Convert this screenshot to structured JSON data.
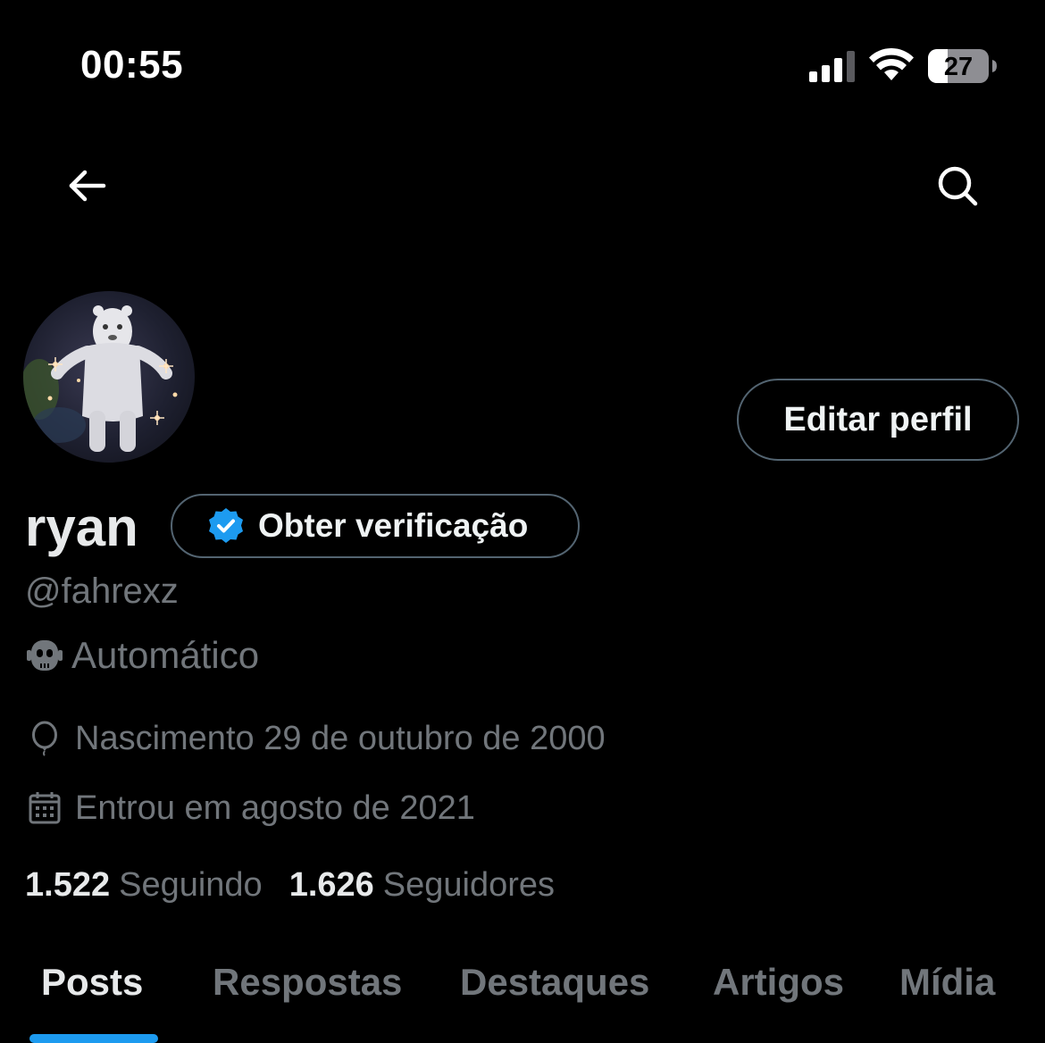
{
  "status_bar": {
    "time": "00:55",
    "battery_level": "27",
    "signal_icon": "cellular-signal-icon",
    "wifi_icon": "wifi-icon",
    "battery_icon": "battery-icon"
  },
  "nav": {
    "back_icon": "arrow-left-icon",
    "search_icon": "search-icon"
  },
  "profile": {
    "name": "ryan",
    "verify_label": "Obter verificação",
    "handle": "@fahrexz",
    "automated_label": "Automático",
    "birth": "Nascimento 29 de outubro de 2000",
    "joined": "Entrou em agosto de 2021",
    "edit_label": "Editar perfil",
    "following_count": "1.522",
    "following_label": "Seguindo",
    "followers_count": "1.626",
    "followers_label": "Seguidores"
  },
  "tabs": [
    {
      "label": "Posts",
      "active": true
    },
    {
      "label": "Respostas",
      "active": false
    },
    {
      "label": "Destaques",
      "active": false
    },
    {
      "label": "Artigos",
      "active": false
    },
    {
      "label": "Mídia",
      "active": false
    }
  ],
  "colors": {
    "background": "#000000",
    "text_primary": "#e7e9ea",
    "text_secondary": "#71767b",
    "border": "#536471",
    "accent": "#1d9bf0"
  }
}
